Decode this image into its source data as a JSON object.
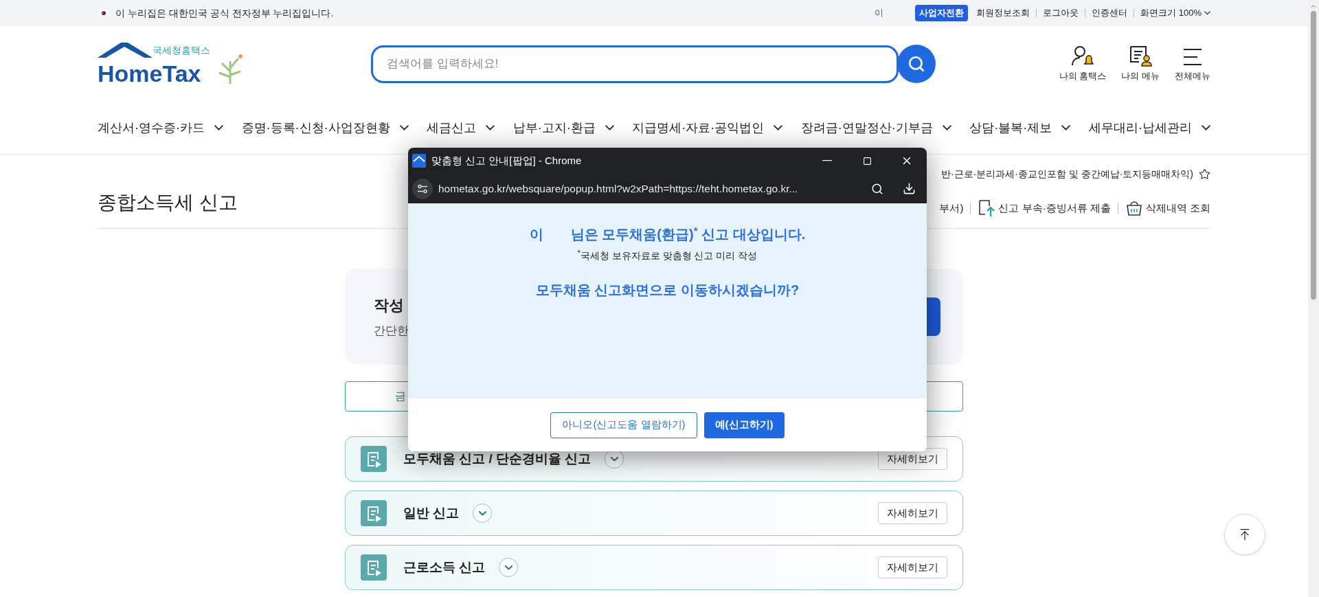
{
  "top_bar": {
    "notice": "이 누리집은 대한민국 공식 전자정부 누리집입니다.",
    "user": "이",
    "links": [
      {
        "label": "사업자전환",
        "kind": "badge"
      },
      {
        "label": "회원정보조회",
        "kind": "link"
      },
      {
        "label": "로그아웃",
        "kind": "link"
      },
      {
        "label": "인증센터",
        "kind": "link"
      },
      {
        "label": "화면크기 100%",
        "kind": "dropdown"
      }
    ]
  },
  "header": {
    "logo": {
      "subtitle": "국세청홈택스",
      "title": "HomeTax"
    },
    "search": {
      "placeholder": "검색어를 입력하세요!"
    },
    "quick_menu": [
      {
        "label": "나의 홈택스"
      },
      {
        "label": "나의 메뉴"
      },
      {
        "label": "전체메뉴"
      }
    ]
  },
  "nav": [
    "계산서·영수증·카드",
    "증명·등록·신청·사업장현황",
    "세금신고",
    "납부·고지·환급",
    "지급명세·자료·공익법인",
    "장려금·연말정산·기부금",
    "상담·불복·제보",
    "세무대리·납세관리"
  ],
  "page": {
    "title": "종합소득세 신고",
    "subtitle": "반·근로·분리과세·종교인포함 및 중간예납·토지등매매차익)",
    "actions": [
      {
        "label": "부서)",
        "kind": "text"
      },
      {
        "label": "신고 부속·증빙서류 제출",
        "kind": "upload"
      },
      {
        "label": "삭제내역 조회",
        "kind": "basket"
      }
    ]
  },
  "intro_card": {
    "title": "작성",
    "description": "간단한"
  },
  "filter_button": {
    "label": "금"
  },
  "report_types": [
    {
      "title": "모두채움 신고 / 단순경비율 신고",
      "detail": "자세히보기"
    },
    {
      "title": "일반 신고",
      "detail": "자세히보기"
    },
    {
      "title": "근로소득 신고",
      "detail": "자세히보기"
    }
  ],
  "popup": {
    "window_title": "맞춤형 신고 안내[팝업] - Chrome",
    "url": "hometax.go.kr/websquare/popup.html?w2xPath=https://teht.hometax.go.kr...",
    "name": "이",
    "headline": "님은 모두채움(환급)$^{*}$ 신고 대상입니다.",
    "note": "$^{*}$국세청 보유자료로 맞춤형 신고 미리 작성",
    "question": "모두채움 신고화면으로 이동하시겠습니까?",
    "buttons": [
      {
        "label": "아니오(신고도움 열람하기)",
        "kind": "secondary"
      },
      {
        "label": "예(신고하기)",
        "kind": "primary"
      }
    ]
  }
}
